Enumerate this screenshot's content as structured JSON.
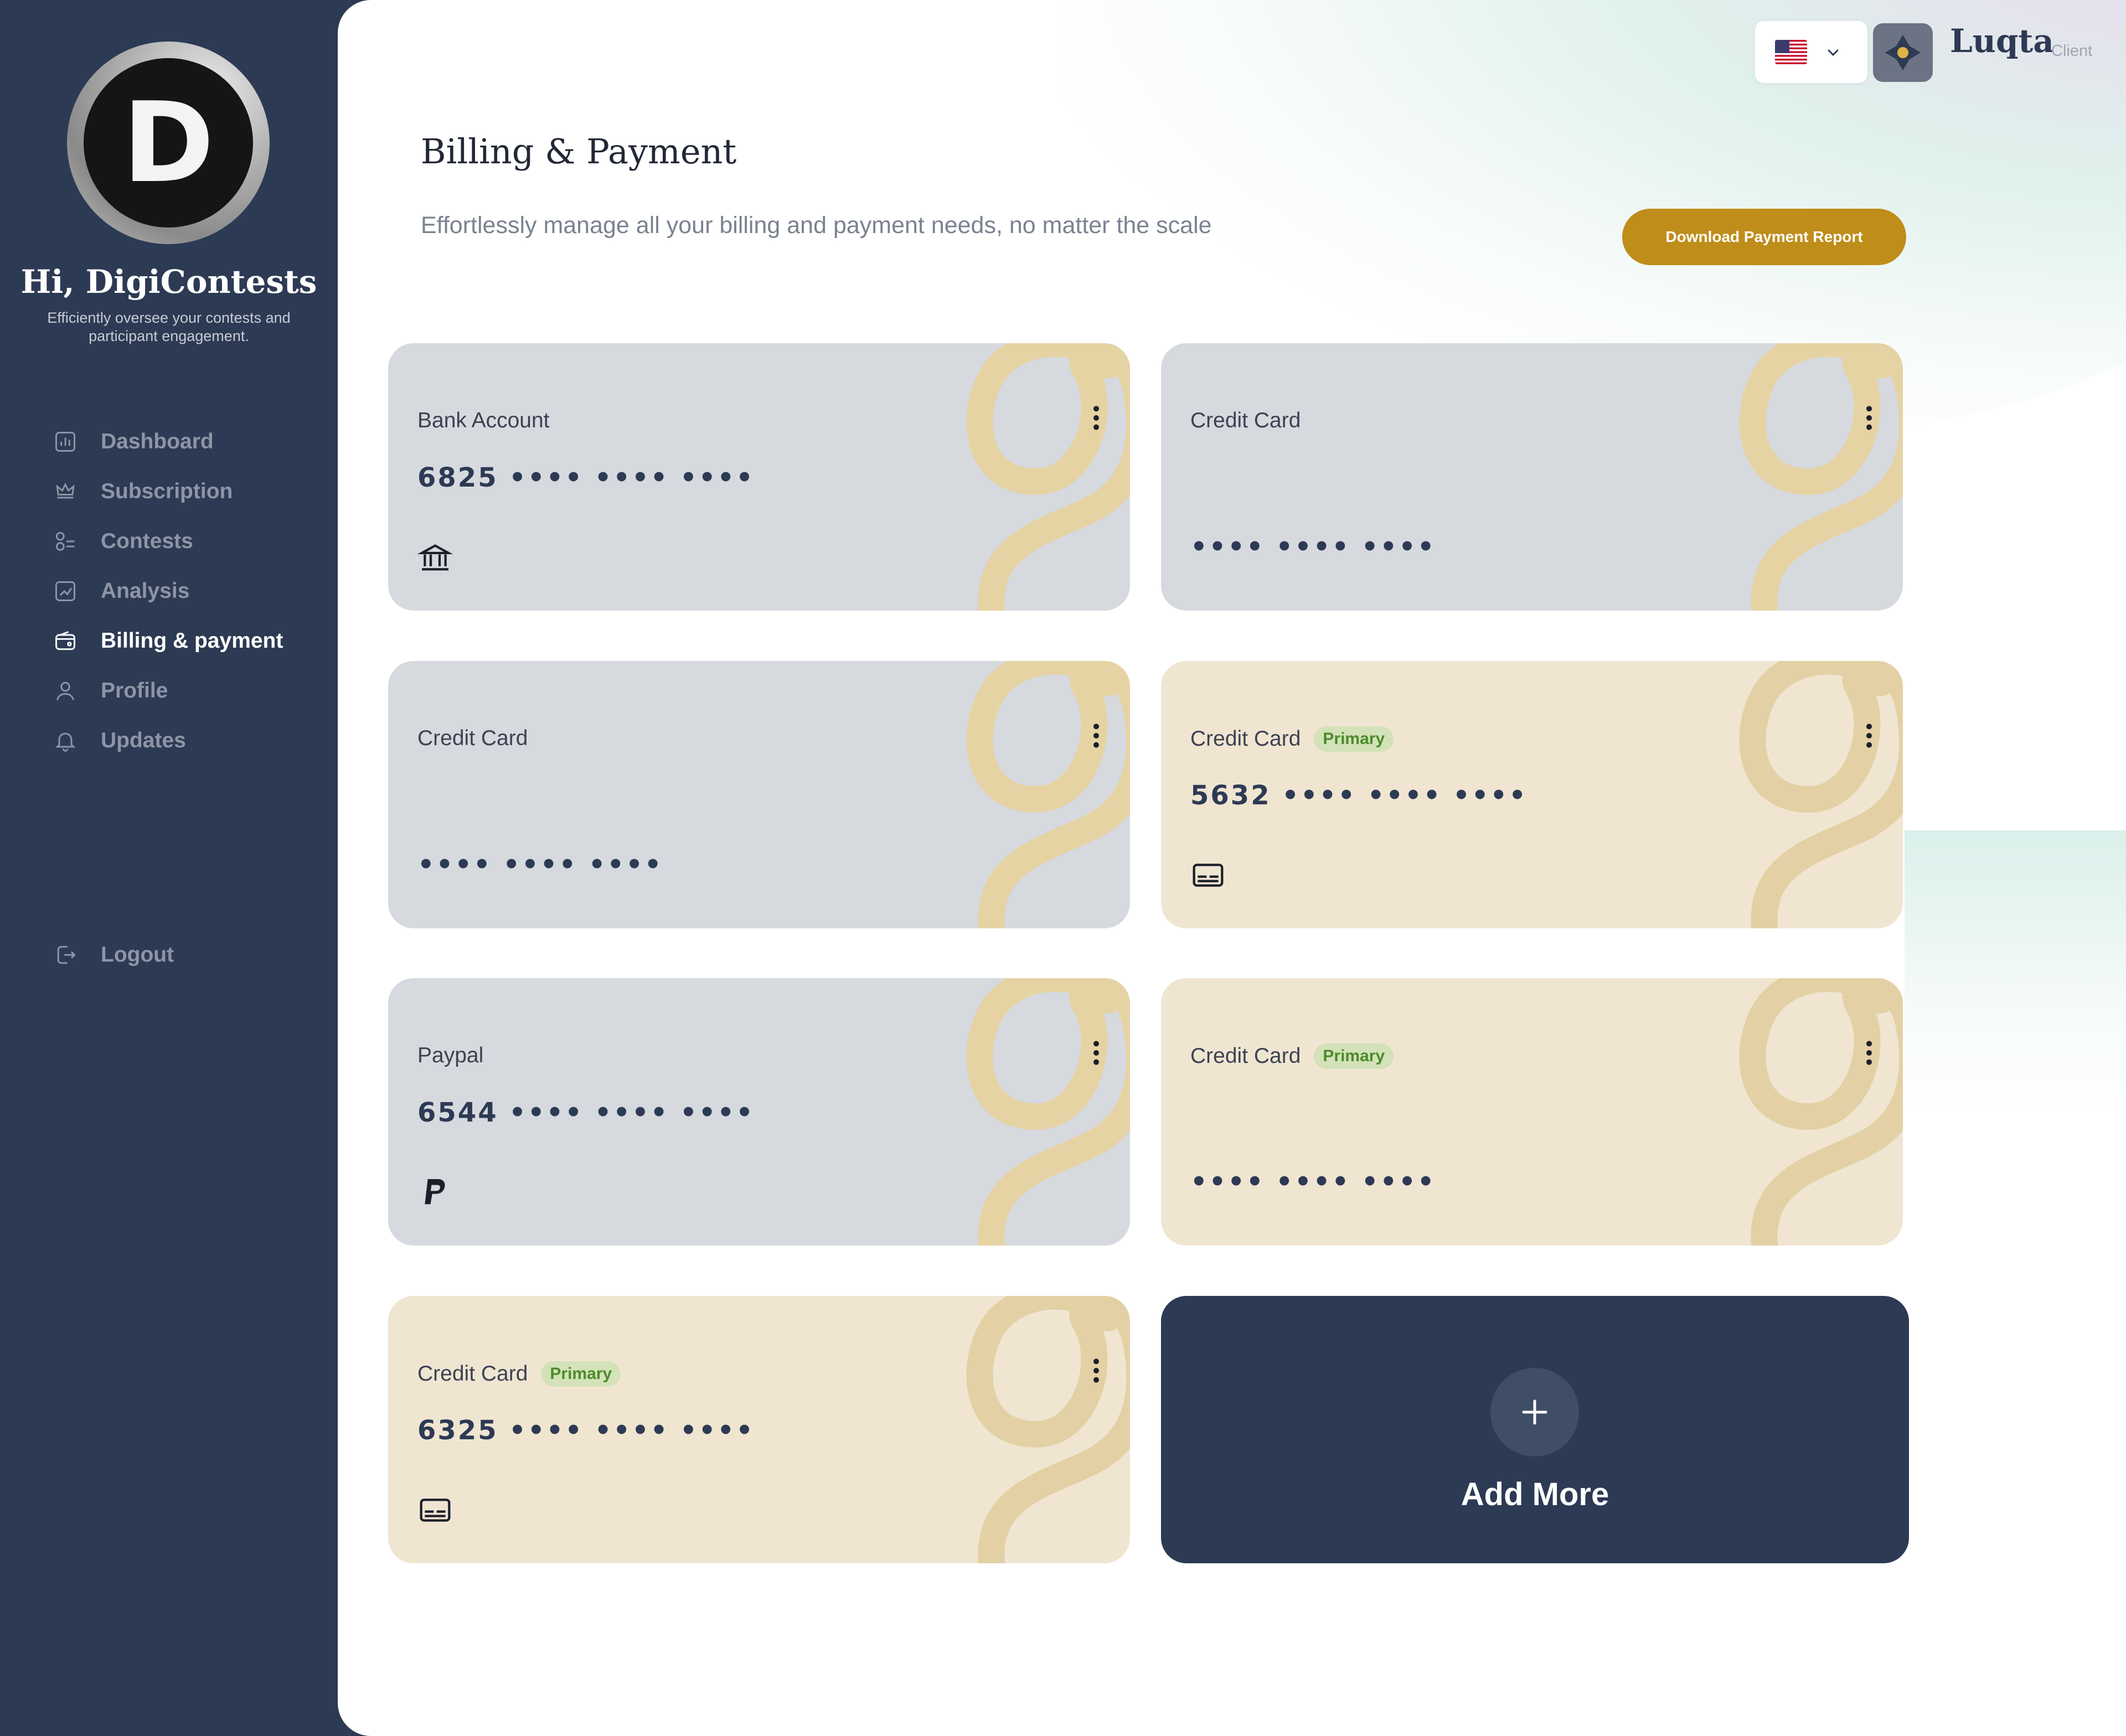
{
  "user": {
    "avatar_letter": "D",
    "greeting": "Hi, DigiContests",
    "tagline": "Efficiently oversee your contests and participant engagement."
  },
  "nav": {
    "items": [
      {
        "label": "Dashboard",
        "icon": "dashboard-icon"
      },
      {
        "label": "Subscription",
        "icon": "crown-icon"
      },
      {
        "label": "Contests",
        "icon": "contests-icon"
      },
      {
        "label": "Analysis",
        "icon": "chart-icon"
      },
      {
        "label": "Billing & payment",
        "icon": "wallet-icon",
        "active": true
      },
      {
        "label": "Profile",
        "icon": "user-icon"
      },
      {
        "label": "Updates",
        "icon": "bell-icon"
      }
    ],
    "logout": "Logout"
  },
  "header": {
    "brand": "Luqta",
    "role": "Client",
    "language_flag": "us-flag-icon"
  },
  "page": {
    "title": "Billing & Payment",
    "subtitle": "Effortlessly manage all your billing and payment needs, no matter the scale",
    "download_button": "Download Payment Report"
  },
  "cards": [
    {
      "label": "Bank Account",
      "number": "6825 •••• •••• ••••",
      "badge": "",
      "icon": "bank-icon"
    },
    {
      "label": "Credit Card",
      "number": "•••• •••• ••••",
      "badge": "",
      "icon": ""
    },
    {
      "label": "Credit Card",
      "number": "•••• •••• ••••",
      "badge": "",
      "icon": ""
    },
    {
      "label": "Credit Card",
      "number": "5632 •••• •••• ••••",
      "badge": "Primary",
      "icon": "card-icon"
    },
    {
      "label": "Paypal",
      "number": "6544 •••• •••• ••••",
      "badge": "",
      "icon": "paypal-icon"
    },
    {
      "label": "Credit Card",
      "number": "•••• •••• ••••",
      "badge": "Primary",
      "icon": ""
    },
    {
      "label": "Credit Card",
      "number": "6325 •••• •••• ••••",
      "badge": "Primary",
      "icon": "card-icon"
    }
  ],
  "add_more": "Add More",
  "colors": {
    "sidebar": "#2d3a54",
    "accent": "#bf8d1a",
    "card_grey": "#d6d9de",
    "card_beige": "#f0e5d1",
    "primary_badge": "#d3e2b8"
  }
}
